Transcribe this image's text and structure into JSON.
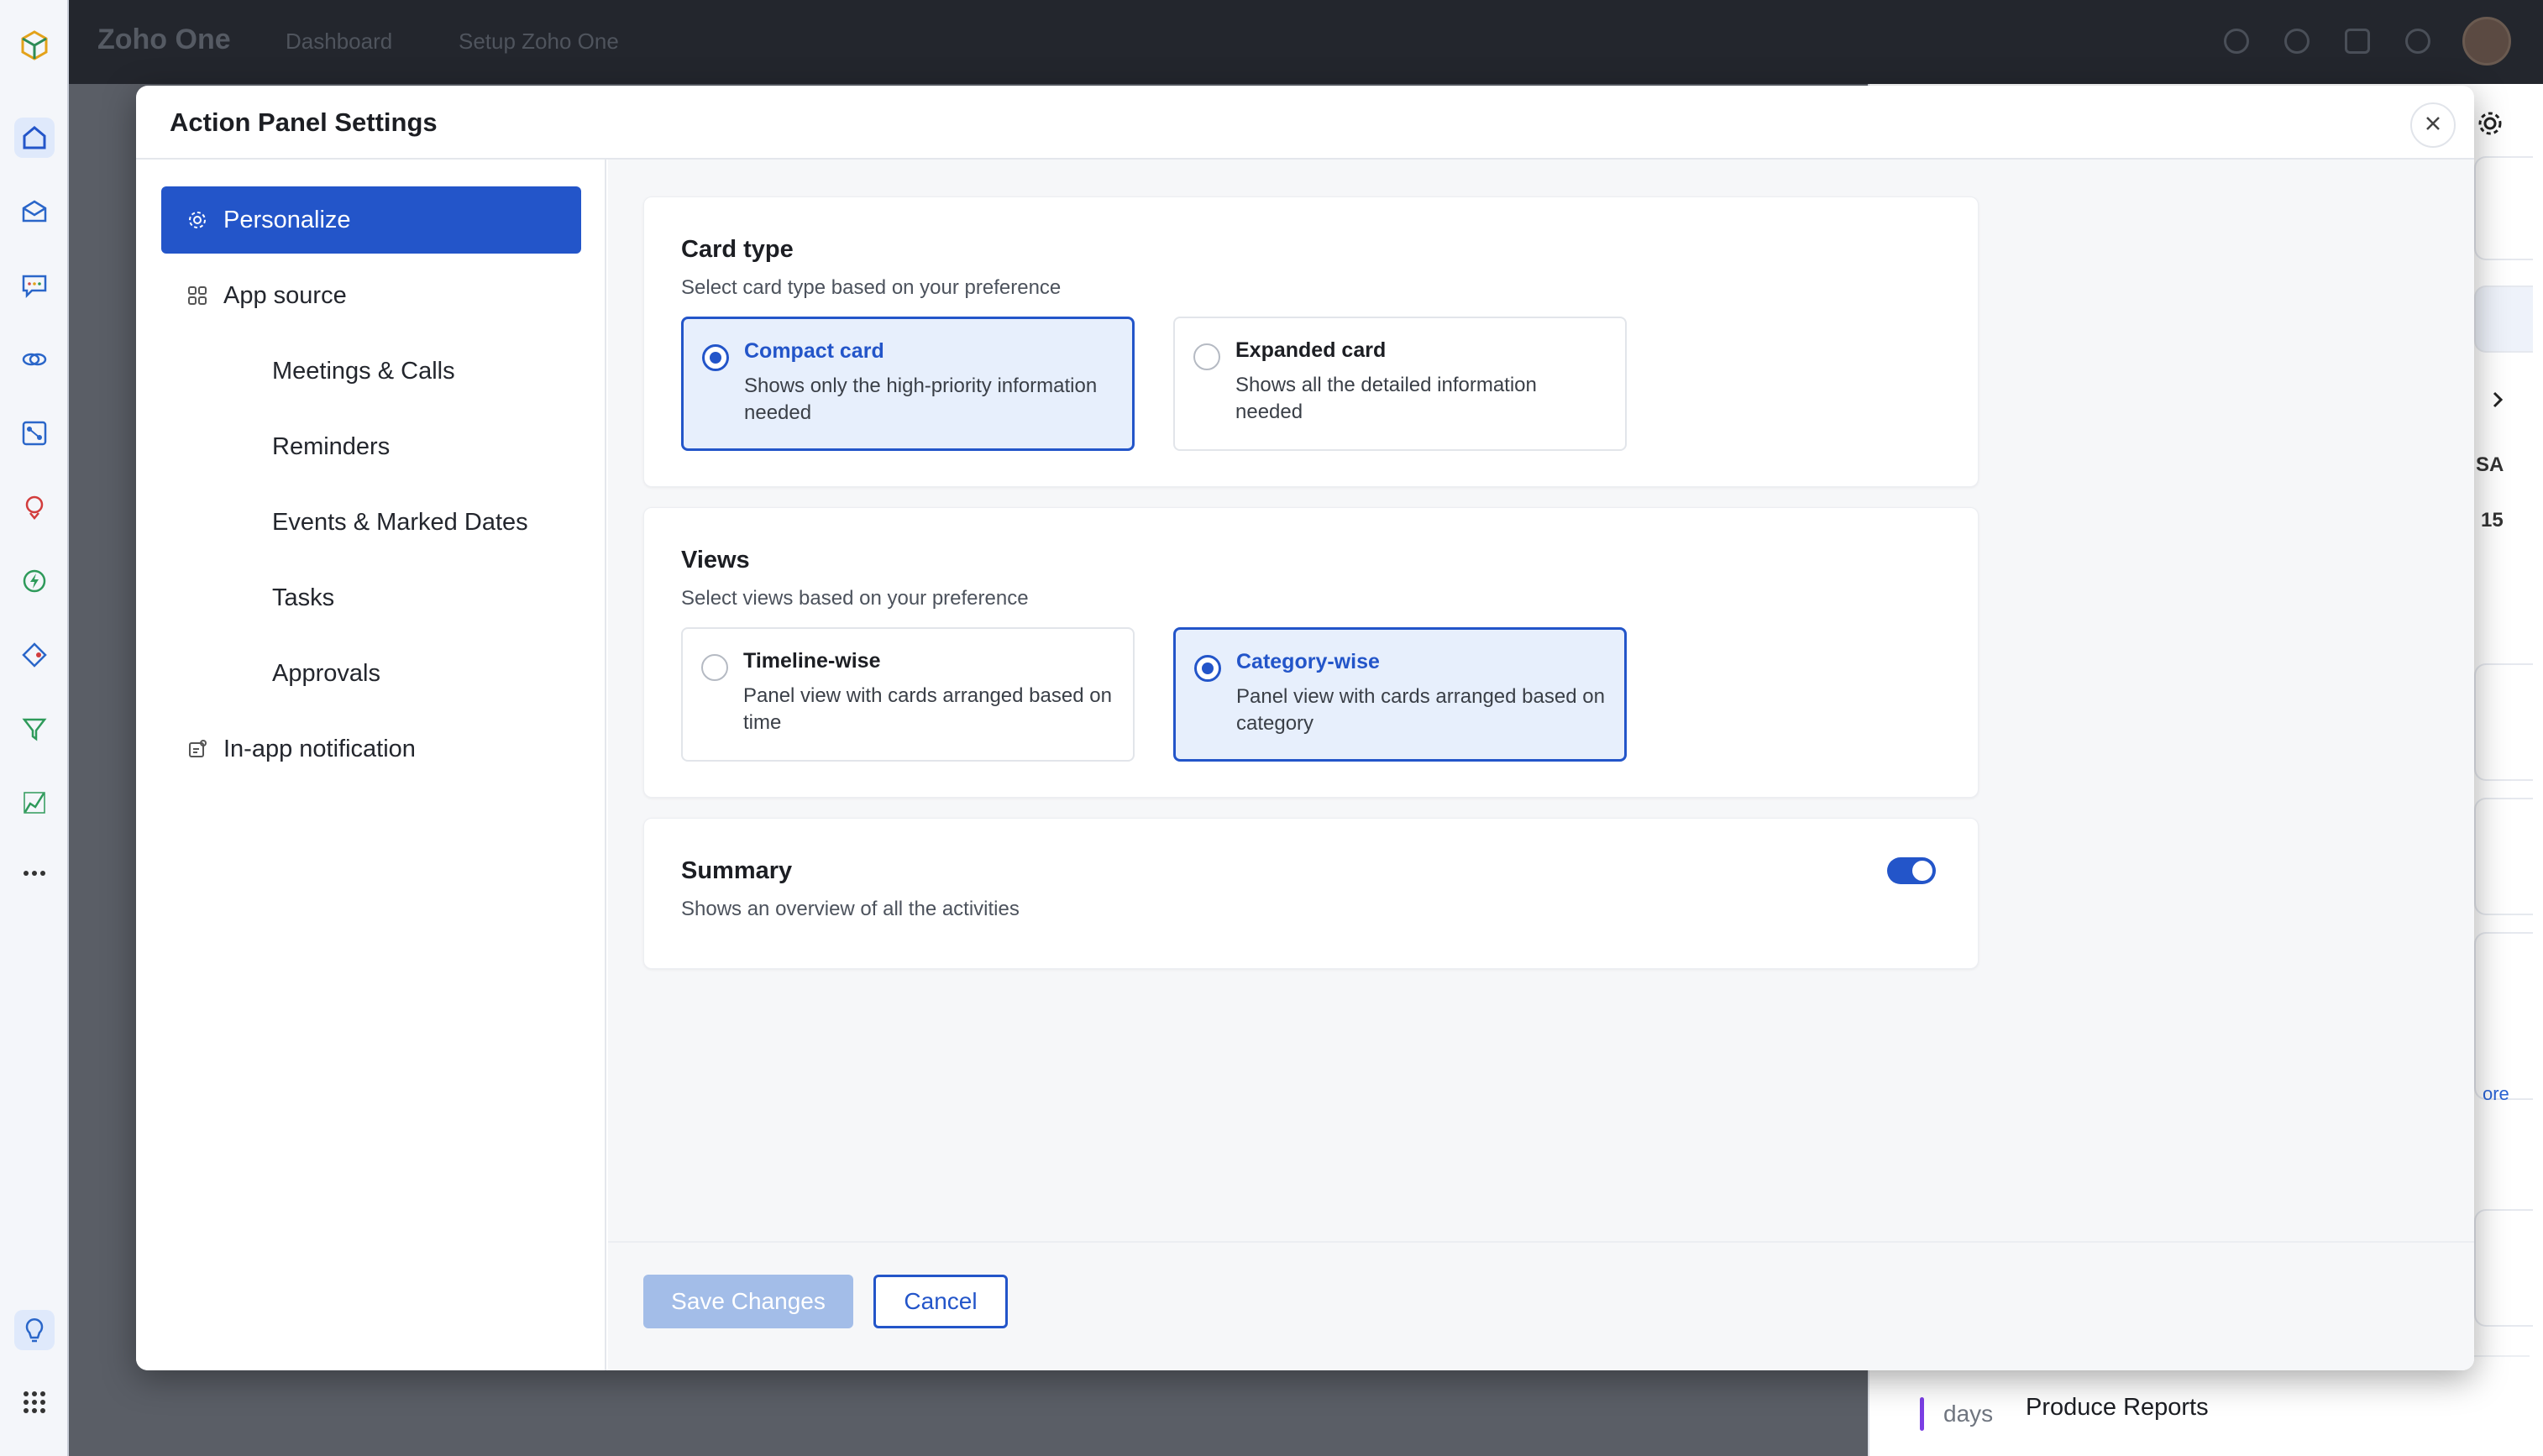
{
  "background_app": {
    "brand": "Zoho One",
    "tabs": [
      "Dashboard",
      "Setup Zoho One"
    ],
    "right_panel": {
      "letters": "SA",
      "number": "15",
      "more_link": "ore",
      "bottom_days": "days",
      "bottom_task": "Produce Reports"
    }
  },
  "modal": {
    "title": "Action Panel Settings",
    "sidebar": {
      "items": [
        {
          "label": "Personalize",
          "icon": "gear-icon",
          "active": true
        },
        {
          "label": "App source",
          "icon": "grid-icon",
          "active": false
        },
        {
          "label": "In-app notification",
          "icon": "notification-icon",
          "active": false
        }
      ],
      "sub_items": [
        "Meetings & Calls",
        "Reminders",
        "Events & Marked Dates",
        "Tasks",
        "Approvals"
      ]
    },
    "card_type": {
      "title": "Card type",
      "subtitle": "Select card type based on your preference",
      "options": [
        {
          "title": "Compact card",
          "desc": "Shows only the high-priority information needed",
          "selected": true
        },
        {
          "title": "Expanded card",
          "desc": "Shows all the detailed information needed",
          "selected": false
        }
      ]
    },
    "views": {
      "title": "Views",
      "subtitle": "Select views based on your preference",
      "options": [
        {
          "title": "Timeline-wise",
          "desc": "Panel view with cards arranged based on time",
          "selected": false
        },
        {
          "title": "Category-wise",
          "desc": "Panel view with cards arranged based on category",
          "selected": true
        }
      ]
    },
    "summary": {
      "title": "Summary",
      "subtitle": "Shows an overview of all the activities",
      "enabled": true
    },
    "footer": {
      "save_label": "Save Changes",
      "cancel_label": "Cancel"
    }
  },
  "colors": {
    "accent": "#2355c9",
    "selected_bg": "#e7effc",
    "save_disabled": "#a3bde8"
  }
}
